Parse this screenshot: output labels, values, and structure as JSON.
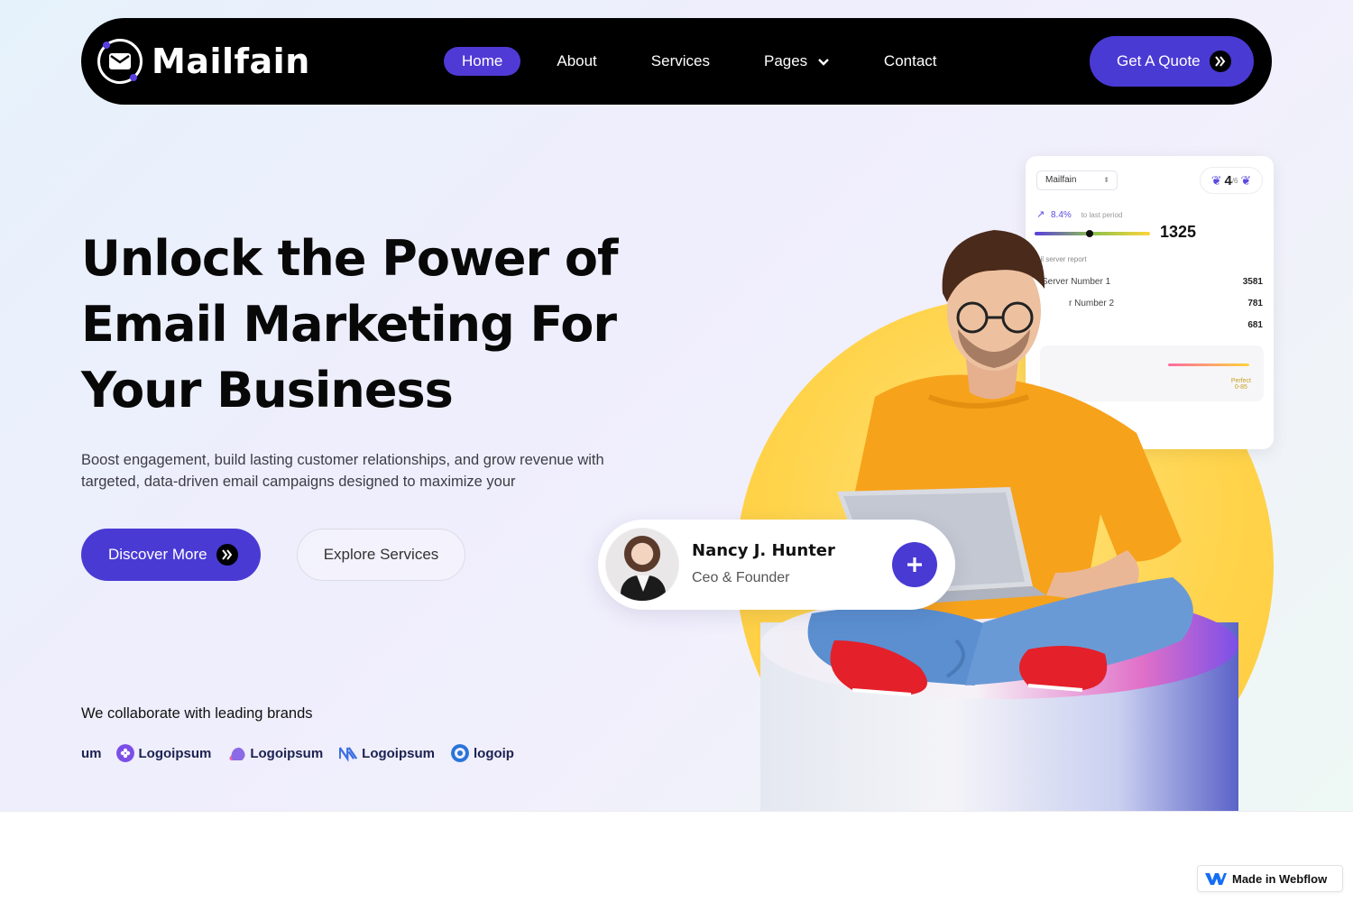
{
  "nav": {
    "brand": "Mailfain",
    "items": [
      {
        "label": "Home",
        "active": true
      },
      {
        "label": "About",
        "active": false
      },
      {
        "label": "Services",
        "active": false
      },
      {
        "label": "Pages",
        "active": false,
        "has_dropdown": true
      },
      {
        "label": "Contact",
        "active": false
      }
    ],
    "cta_label": "Get A Quote"
  },
  "hero": {
    "headline_line1": "Unlock the Power of",
    "headline_line2": "Email Marketing For",
    "headline_line3": "Your Business",
    "subtext": "Boost engagement, build lasting customer relationships, and grow revenue with targeted, data-driven email campaigns designed to maximize your",
    "primary_button": "Discover More",
    "secondary_button": "Explore Services",
    "brands_label": "We collaborate with leading brands",
    "brands": [
      {
        "label": "um",
        "partial": true
      },
      {
        "label": "Logoipsum",
        "color": "#7b4ee8"
      },
      {
        "label": "Logoipsum",
        "color": "#e66aa8"
      },
      {
        "label": "Logoipsum",
        "color": "#3d6fe0"
      },
      {
        "label": "logoips",
        "color": "#2a74d8",
        "partial": true
      }
    ]
  },
  "dashboard": {
    "select_value": "Mailfain",
    "rating_value": "4",
    "rating_max": "/6",
    "trend_value": "8.4%",
    "trend_note": "to last period",
    "progress_fraction": 0.48,
    "total": "1325",
    "report_title": "ail server report",
    "rows": [
      {
        "label": "Server Number 1",
        "value": "3581"
      },
      {
        "label": "r Number 2",
        "value": "781"
      },
      {
        "label": "",
        "value": "681"
      }
    ],
    "perfect_label": "Perfect",
    "perfect_range": "0-85"
  },
  "profile": {
    "name": "Nancy J. Hunter",
    "role": "Ceo & Founder"
  },
  "webflow_badge": "Made in Webflow",
  "colors": {
    "accent": "#4a3ad4",
    "nav_bg": "#000000",
    "sun": "#ffd34a"
  }
}
